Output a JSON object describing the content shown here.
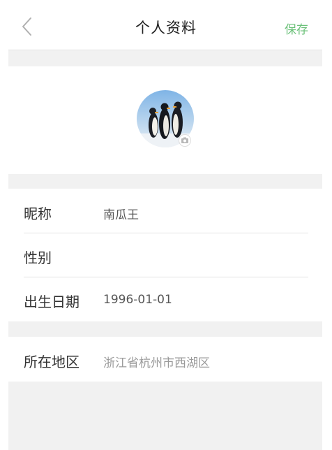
{
  "header": {
    "title": "个人资料",
    "save_label": "保存",
    "back_icon": "chevron-left-icon"
  },
  "avatar": {
    "badge_icon": "camera-icon"
  },
  "profile": {
    "nickname": {
      "label": "昵称",
      "value": "南瓜王"
    },
    "gender": {
      "label": "性别",
      "value": ""
    },
    "birthday": {
      "label": "出生日期",
      "value": "1996-01-01"
    },
    "region": {
      "label": "所在地区",
      "value": "浙江省杭州市西湖区"
    }
  },
  "colors": {
    "accent": "#6cc17a",
    "separator": "#f1f1f1",
    "text": "#333333",
    "muted": "#9a9a9a"
  }
}
